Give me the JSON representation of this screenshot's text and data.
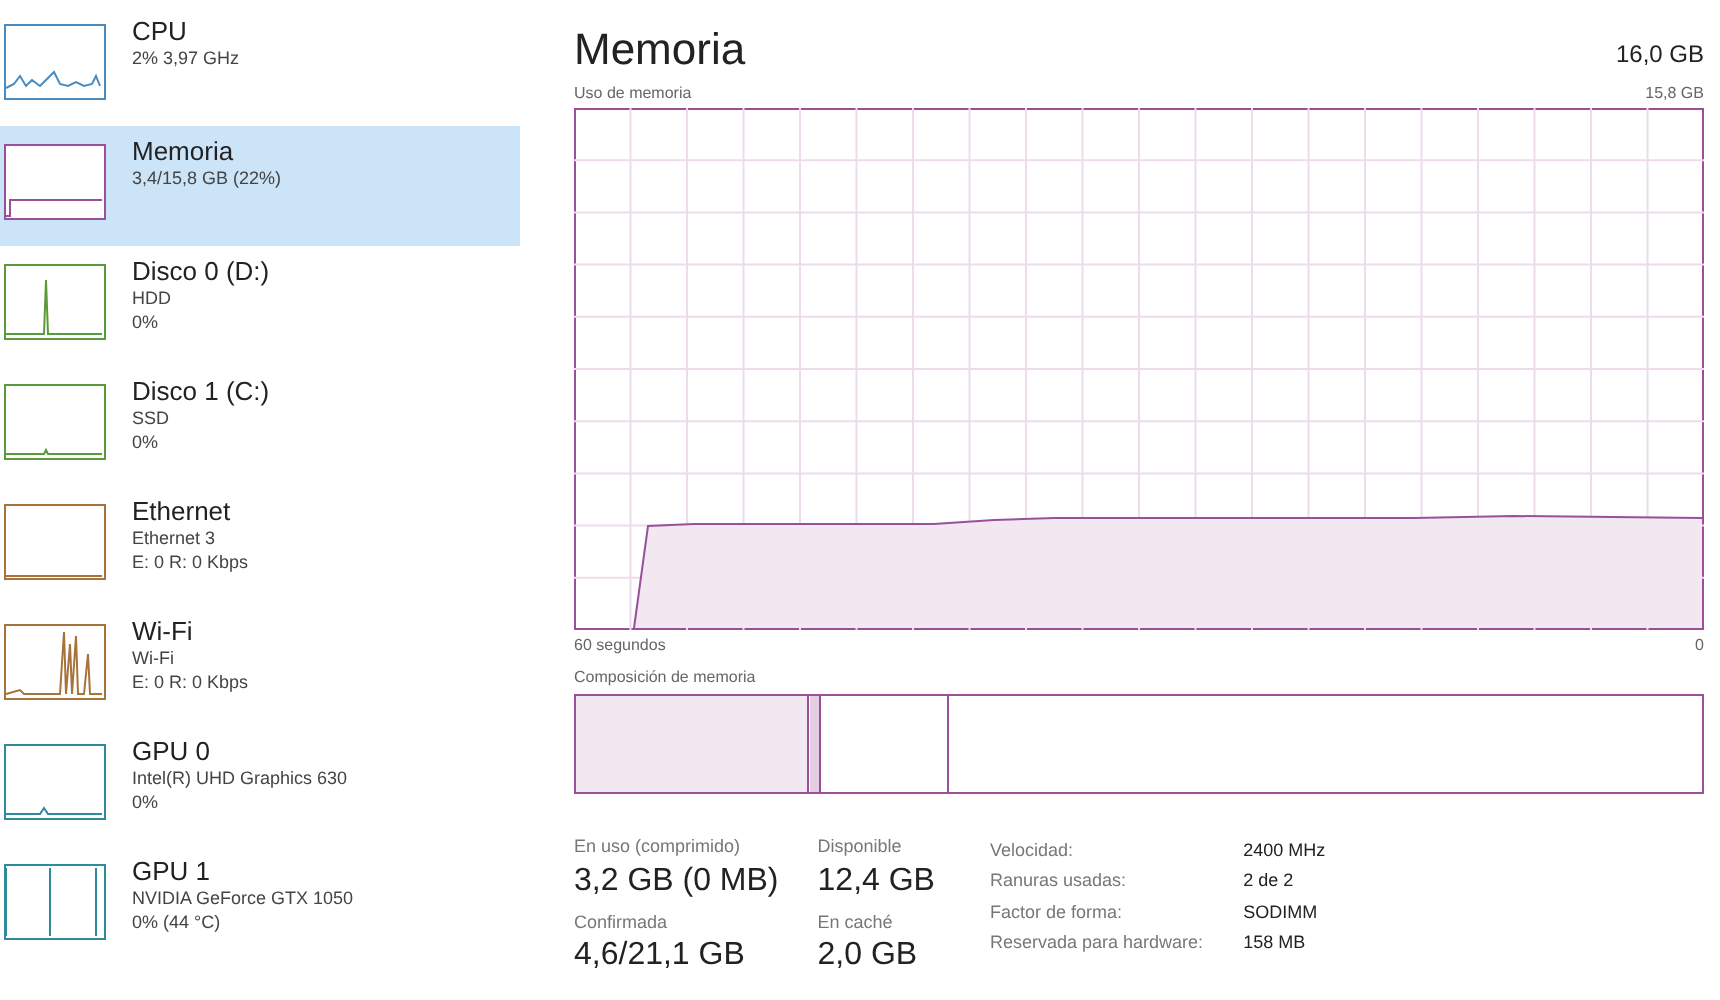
{
  "sidebar": {
    "items": [
      {
        "title": "CPU",
        "lines": [
          "2% 3,97 GHz"
        ],
        "selected": false,
        "color": "#4a8bbf"
      },
      {
        "title": "Memoria",
        "lines": [
          "3,4/15,8 GB (22%)"
        ],
        "selected": true,
        "color": "#9b4f9b"
      },
      {
        "title": "Disco 0 (D:)",
        "lines": [
          "HDD",
          "0%"
        ],
        "selected": false,
        "color": "#5a9a3a"
      },
      {
        "title": "Disco 1 (C:)",
        "lines": [
          "SSD",
          "0%"
        ],
        "selected": false,
        "color": "#5a9a3a"
      },
      {
        "title": "Ethernet",
        "lines": [
          "Ethernet 3",
          "E: 0 R: 0 Kbps"
        ],
        "selected": false,
        "color": "#a7733a"
      },
      {
        "title": "Wi-Fi",
        "lines": [
          "Wi-Fi",
          "E: 0 R: 0 Kbps"
        ],
        "selected": false,
        "color": "#a7733a"
      },
      {
        "title": "GPU 0",
        "lines": [
          "Intel(R) UHD Graphics 630",
          "0%"
        ],
        "selected": false,
        "color": "#2f8a9a"
      },
      {
        "title": "GPU 1",
        "lines": [
          "NVIDIA GeForce GTX 1050",
          "0% (44 °C)"
        ],
        "selected": false,
        "color": "#2f8a9a"
      }
    ]
  },
  "main": {
    "title": "Memoria",
    "total": "16,0 GB",
    "graph_label": "Uso de memoria",
    "graph_max": "15,8 GB",
    "time_label": "60 segundos",
    "time_end": "0",
    "composition_label": "Composición de memoria",
    "stats": [
      {
        "label": "En uso (comprimido)",
        "value": "3,2 GB (0 MB)"
      },
      {
        "label": "Disponible",
        "value": "12,4 GB"
      },
      {
        "label": "Confirmada",
        "value": "4,6/21,1 GB"
      },
      {
        "label": "En caché",
        "value": "2,0 GB"
      }
    ],
    "details": [
      {
        "label": "Velocidad:",
        "value": "2400 MHz"
      },
      {
        "label": "Ranuras usadas:",
        "value": "2 de 2"
      },
      {
        "label": "Factor de forma:",
        "value": "SODIMM"
      },
      {
        "label": "Reservada para hardware:",
        "value": "158 MB"
      }
    ]
  }
}
